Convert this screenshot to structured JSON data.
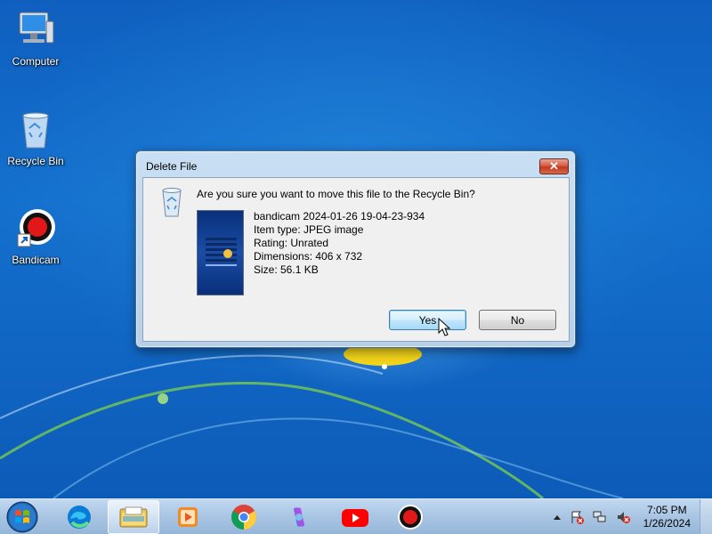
{
  "desktop": {
    "icons": [
      {
        "label": "Computer",
        "icon": "computer-icon"
      },
      {
        "label": "Recycle Bin",
        "icon": "recycle-bin-icon"
      },
      {
        "label": "Bandicam",
        "icon": "bandicam-icon"
      }
    ]
  },
  "dialog": {
    "title": "Delete File",
    "close_label": "✕",
    "question": "Are you sure you want to move this file to the Recycle Bin?",
    "file": {
      "name": "bandicam 2024-01-26 19-04-23-934",
      "type": "Item type: JPEG image",
      "rating": "Rating: Unrated",
      "dimensions": "Dimensions: 406 x 732",
      "size": "Size: 56.1 KB"
    },
    "yes_label": "Yes",
    "no_label": "No"
  },
  "taskbar": {
    "pinned": [
      "start-orb-icon",
      "edge-icon",
      "file-explorer-icon",
      "media-player-icon",
      "chrome-icon",
      "copilot-icon",
      "youtube-icon",
      "bandicam-icon"
    ],
    "active_item": "file-explorer-icon",
    "clock": {
      "time": "7:05 PM",
      "date": "1/26/2024"
    }
  },
  "colors": {
    "desktop_blue": "#1470cd",
    "dialog_frame": "#b7d0ea",
    "close_red": "#c2391d",
    "default_button": "#bee6fd"
  }
}
